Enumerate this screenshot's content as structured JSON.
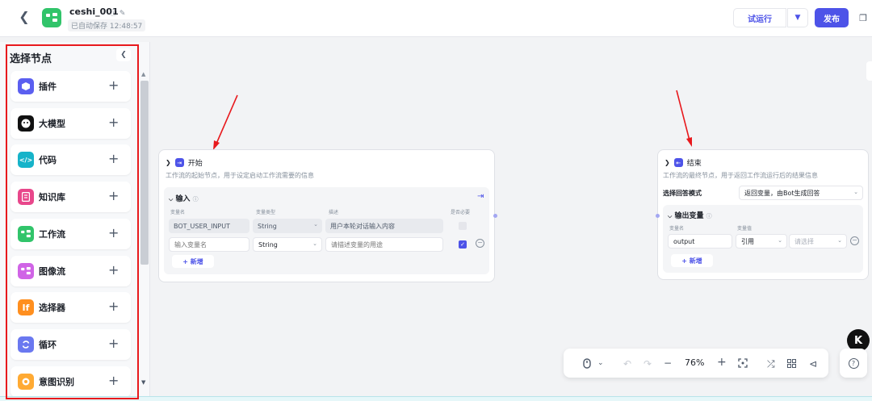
{
  "header": {
    "title": "ceshi_001",
    "save_status": "已自动保存 12:48:57",
    "run_label": "试运行",
    "publish_label": "发布"
  },
  "sidebar": {
    "title": "选择节点",
    "items": [
      {
        "label": "插件",
        "color": "#5b5ff0",
        "icon": "plugin-icon"
      },
      {
        "label": "大模型",
        "color": "#111111",
        "icon": "llm-icon"
      },
      {
        "label": "代码",
        "color": "#16b3c9",
        "icon": "code-icon"
      },
      {
        "label": "知识库",
        "color": "#e8478b",
        "icon": "knowledge-icon"
      },
      {
        "label": "工作流",
        "color": "#31c46a",
        "icon": "workflow-icon"
      },
      {
        "label": "图像流",
        "color": "#d064e6",
        "icon": "imageflow-icon"
      },
      {
        "label": "选择器",
        "color": "#ff8f1f",
        "icon": "selector-icon",
        "glyph": "If"
      },
      {
        "label": "循环",
        "color": "#6a78f0",
        "icon": "loop-icon"
      },
      {
        "label": "意图识别",
        "color": "#ffaa33",
        "icon": "intent-icon"
      }
    ]
  },
  "start_node": {
    "title": "开始",
    "description": "工作流的起始节点，用于设定启动工作流需要的信息",
    "input_title": "输入",
    "columns": {
      "name": "变量名",
      "type": "变量类型",
      "desc": "描述",
      "required": "是否必要"
    },
    "rows": [
      {
        "name": "BOT_USER_INPUT",
        "type": "String",
        "desc": "用户本轮对话输入内容"
      },
      {
        "name_placeholder": "输入变量名",
        "type": "String",
        "desc_placeholder": "请描述变量的用途"
      }
    ],
    "add_label": "+ 新增"
  },
  "end_node": {
    "title": "结束",
    "description": "工作流的最终节点，用于返回工作流运行后的结果信息",
    "mode_label": "选择回答模式",
    "mode_value": "返回变量，由Bot生成回答",
    "output_title": "输出变量",
    "columns": {
      "name": "变量名",
      "value": "变量值"
    },
    "row": {
      "name": "output",
      "ref": "引用",
      "select_placeholder": "请选择"
    },
    "add_label": "+ 新增"
  },
  "toolbar": {
    "zoom": "76%"
  },
  "colors": {
    "accent": "#4d53e8",
    "annotation": "#e8191d"
  }
}
